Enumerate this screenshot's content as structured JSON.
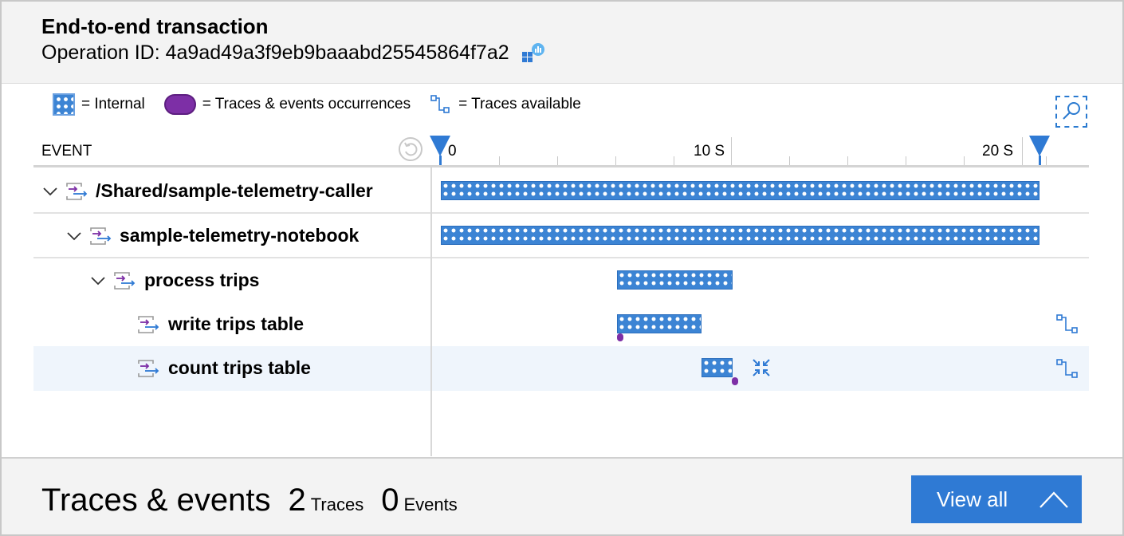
{
  "header": {
    "title": "End-to-end transaction",
    "operation_label": "Operation ID: 4a9ad49a3f9eb9baaabd25545864f7a2"
  },
  "legend": {
    "internal": "= Internal",
    "traces_events": "= Traces & events occurrences",
    "traces_available": "= Traces available"
  },
  "grid": {
    "event_header": "EVENT",
    "ticks": [
      "0",
      "10 S",
      "20 S"
    ]
  },
  "rows": [
    {
      "label": "/Shared/sample-telemetry-caller"
    },
    {
      "label": "sample-telemetry-notebook"
    },
    {
      "label": "process trips"
    },
    {
      "label": "write trips table"
    },
    {
      "label": "count trips table"
    }
  ],
  "footer": {
    "title": "Traces & events",
    "traces_count": "2",
    "traces_unit": "Traces",
    "events_count": "0",
    "events_unit": "Events",
    "view_all": "View all"
  },
  "colors": {
    "bar": "#3c84d4",
    "occurrence": "#7d2fa6",
    "accent": "#2f7ad4"
  }
}
